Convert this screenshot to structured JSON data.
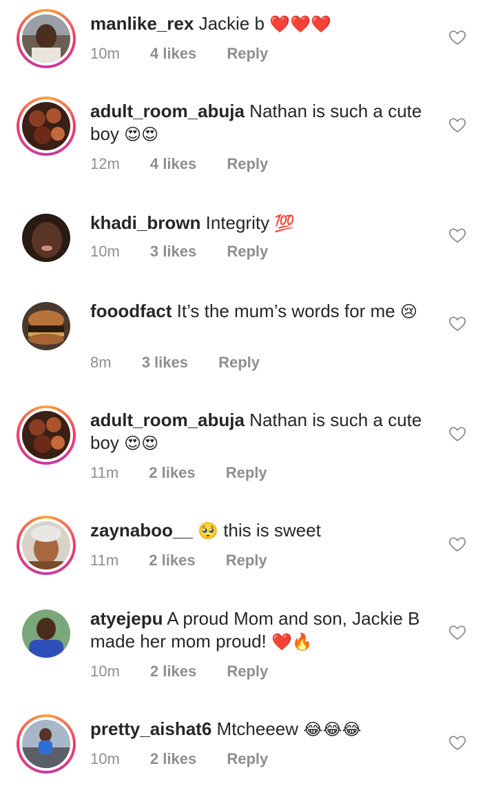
{
  "comments": [
    {
      "username": "manlike_rex",
      "text": "Jackie b",
      "emoji": "❤️❤️❤️",
      "time": "10m",
      "likes": "4 likes",
      "reply": "Reply"
    },
    {
      "username": "adult_room_abuja",
      "text": "Nathan is such a cute boy",
      "emoji": "😍😍",
      "time": "12m",
      "likes": "4 likes",
      "reply": "Reply"
    },
    {
      "username": "khadi_brown",
      "text": "Integrity",
      "emoji": "💯",
      "time": "10m",
      "likes": "3 likes",
      "reply": "Reply"
    },
    {
      "username": "fooodfact",
      "text": "It’s the mum’s words for me",
      "emoji": "😢",
      "time": "8m",
      "likes": "3 likes",
      "reply": "Reply"
    },
    {
      "username": "adult_room_abuja",
      "text": "Nathan is such a cute boy",
      "emoji": "😍😍",
      "time": "11m",
      "likes": "2 likes",
      "reply": "Reply"
    },
    {
      "username": "zaynaboo__",
      "emoji_pre": "🥺",
      "text": "this is sweet",
      "time": "11m",
      "likes": "2 likes",
      "reply": "Reply"
    },
    {
      "username": "atyejepu",
      "text": "A proud Mom and son, Jackie B made her mom proud!",
      "emoji": "❤️🔥",
      "time": "10m",
      "likes": "2 likes",
      "reply": "Reply"
    },
    {
      "username": "pretty_aishat6",
      "text": "Mtcheeew",
      "emoji": "😂😂😂",
      "time": "10m",
      "likes": "2 likes",
      "reply": "Reply"
    }
  ],
  "icons": {
    "like": "heart-outline-icon"
  },
  "colors": {
    "text": "#262626",
    "meta": "#8e8e8e",
    "story_ring_start": "#f9a43a",
    "story_ring_end": "#c53aa5"
  }
}
